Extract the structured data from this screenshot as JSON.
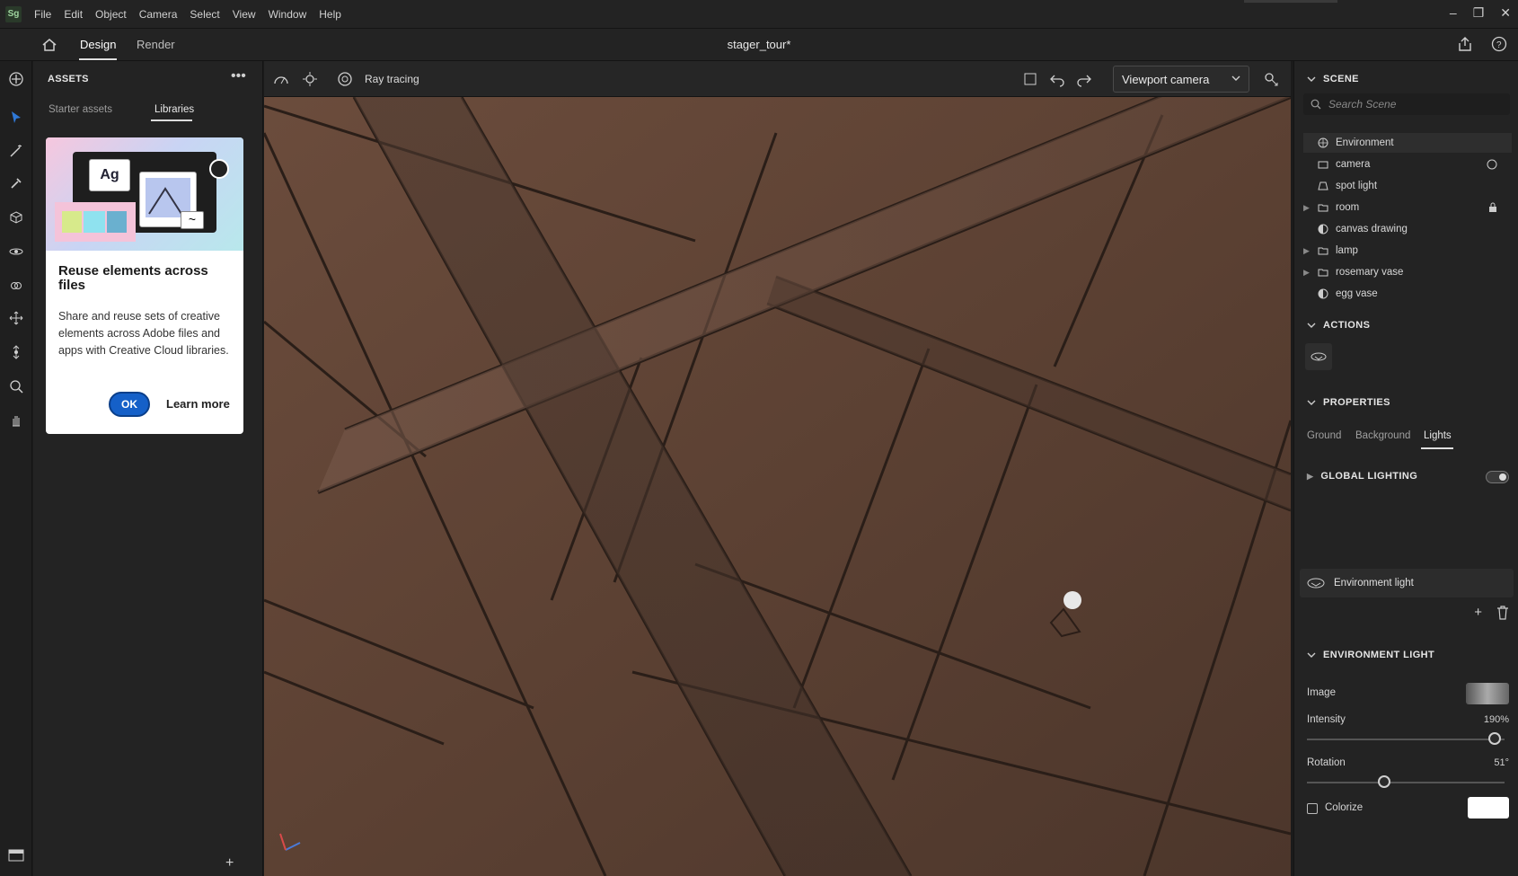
{
  "app": {
    "logo_text": "Sg",
    "title": "stager_tour*"
  },
  "menu": [
    "File",
    "Edit",
    "Object",
    "Camera",
    "Select",
    "View",
    "Window",
    "Help"
  ],
  "modes": {
    "design": "Design",
    "render": "Render"
  },
  "assets": {
    "title": "ASSETS",
    "tabs": [
      "Starter assets",
      "Libraries"
    ],
    "active_tab": "Libraries",
    "card": {
      "illus_text": "Ag",
      "title": "Reuse elements across files",
      "body": "Share and reuse sets of creative elements across Adobe files and apps with Creative Cloud libraries.",
      "ok": "OK",
      "learn_more": "Learn more"
    }
  },
  "viewport_toolbar": {
    "ray_tracing": "Ray tracing",
    "camera": "Viewport camera"
  },
  "scene": {
    "title": "SCENE",
    "search_placeholder": "Search Scene",
    "items": [
      {
        "label": "Environment",
        "icon": "globe-icon",
        "expandable": false
      },
      {
        "label": "camera",
        "icon": "camera-icon",
        "expandable": false
      },
      {
        "label": "spot light",
        "icon": "spotlight-icon",
        "expandable": false
      },
      {
        "label": "room",
        "icon": "folder-icon",
        "expandable": true
      },
      {
        "label": "canvas drawing",
        "icon": "object-icon",
        "expandable": false
      },
      {
        "label": "lamp",
        "icon": "folder-icon",
        "expandable": true
      },
      {
        "label": "rosemary vase",
        "icon": "folder-icon",
        "expandable": true
      },
      {
        "label": "egg vase",
        "icon": "object-icon",
        "expandable": false
      }
    ]
  },
  "actions": {
    "title": "ACTIONS"
  },
  "properties": {
    "title": "PROPERTIES",
    "tabs": [
      "Ground",
      "Background",
      "Lights"
    ],
    "active_tab": "Lights",
    "global_lighting": "GLOBAL LIGHTING",
    "environment_light_item": "Environment light",
    "environment_light_section": "ENVIRONMENT LIGHT",
    "image_label": "Image",
    "intensity_label": "Intensity",
    "intensity_value": "190%",
    "intensity_fraction": 0.95,
    "rotation_label": "Rotation",
    "rotation_value": "51°",
    "rotation_fraction": 0.39,
    "colorize_label": "Colorize",
    "colorize_color": "#ffffff"
  },
  "colors": {
    "accent": "#1560c8",
    "panel": "#232323",
    "wood": "#5a4034"
  }
}
